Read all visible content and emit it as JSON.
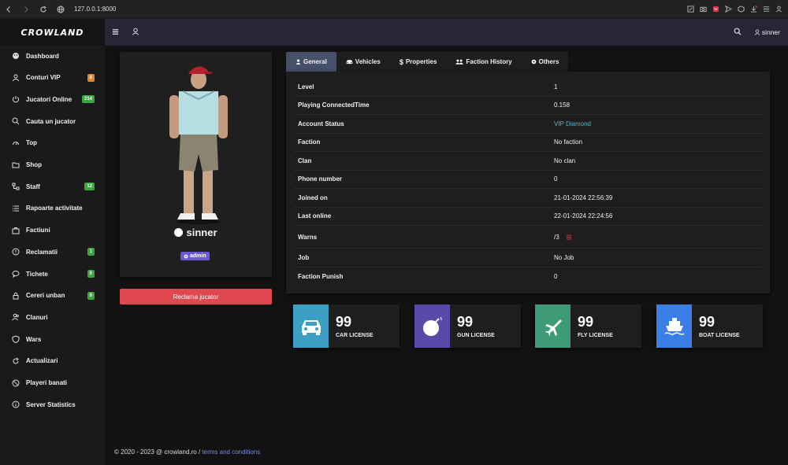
{
  "browser": {
    "url": "127.0.0.1:8000"
  },
  "brand": {
    "logo_text": "CROWLAND"
  },
  "sidebar": {
    "items": [
      {
        "label": "Dashboard",
        "icon": "palette-icon"
      },
      {
        "label": "Conturi VIP",
        "icon": "user-group-icon",
        "badge": "0",
        "badge_color": "#e8832a"
      },
      {
        "label": "Jucatori Online",
        "icon": "power-icon",
        "badge": "214",
        "badge_color": "#3aa640"
      },
      {
        "label": "Cauta un jucator",
        "icon": "search-icon"
      },
      {
        "label": "Top",
        "icon": "gauge-icon"
      },
      {
        "label": "Shop",
        "icon": "folder-icon"
      },
      {
        "label": "Staff",
        "icon": "hierarchy-icon",
        "badge": "12",
        "badge_color": "#3aa640"
      },
      {
        "label": "Rapoarte activitate",
        "icon": "list-icon"
      },
      {
        "label": "Factiuni",
        "icon": "briefcase-icon"
      },
      {
        "label": "Reclamatii",
        "icon": "alert-icon",
        "badge": "1",
        "badge_color": "#3aa640"
      },
      {
        "label": "Tichete",
        "icon": "chat-icon",
        "badge": "0",
        "badge_color": "#3aa640"
      },
      {
        "label": "Cereri unban",
        "icon": "lock-icon",
        "badge": "0",
        "badge_color": "#3aa640"
      },
      {
        "label": "Clanuri",
        "icon": "users-icon"
      },
      {
        "label": "Wars",
        "icon": "shield-icon"
      },
      {
        "label": "Actualizari",
        "icon": "refresh-icon"
      },
      {
        "label": "Playeri banati",
        "icon": "ban-icon"
      },
      {
        "label": "Server Statistics",
        "icon": "info-icon"
      }
    ]
  },
  "header": {
    "username": "sinner"
  },
  "profile": {
    "name": "sinner",
    "role": "admin",
    "report_button": "Reclama jucator"
  },
  "tabs": [
    {
      "label": "General",
      "icon": "user-icon"
    },
    {
      "label": "Vehicles",
      "icon": "car-icon"
    },
    {
      "label": "Properties",
      "icon": "dollar-icon"
    },
    {
      "label": "Faction History",
      "icon": "users-icon"
    },
    {
      "label": "Others",
      "icon": "gear-icon"
    }
  ],
  "general": {
    "rows": [
      {
        "label": "Level",
        "value": "1"
      },
      {
        "label": "Playing ConnectedTime",
        "value": "0.158"
      },
      {
        "label": "Account Status",
        "value": "VIP Diamond"
      },
      {
        "label": "Faction",
        "value": "No faction"
      },
      {
        "label": "Clan",
        "value": "No clan"
      },
      {
        "label": "Phone number",
        "value": "0"
      },
      {
        "label": "Joined on",
        "value": "21-01-2024 22:56:39"
      },
      {
        "label": "Last online",
        "value": "22-01-2024 22:24:56"
      },
      {
        "label": "Warns",
        "value": "/3"
      },
      {
        "label": "Job",
        "value": "No Job"
      },
      {
        "label": "Faction Punish",
        "value": "0"
      }
    ]
  },
  "licenses": [
    {
      "value": "99",
      "label": "CAR LICENSE",
      "icon": "car-icon",
      "color": "#3ba0c4"
    },
    {
      "value": "99",
      "label": "GUN LICENSE",
      "icon": "bomb-icon",
      "color": "#5a49a8"
    },
    {
      "value": "99",
      "label": "FLY LICENSE",
      "icon": "plane-icon",
      "color": "#3f9a78"
    },
    {
      "value": "99",
      "label": "BOAT LICENSE",
      "icon": "ship-icon",
      "color": "#3a7ee6"
    }
  ],
  "footer": {
    "text": "© 2020 - 2023 @ crowland.ro /",
    "link": "terms and conditions"
  }
}
